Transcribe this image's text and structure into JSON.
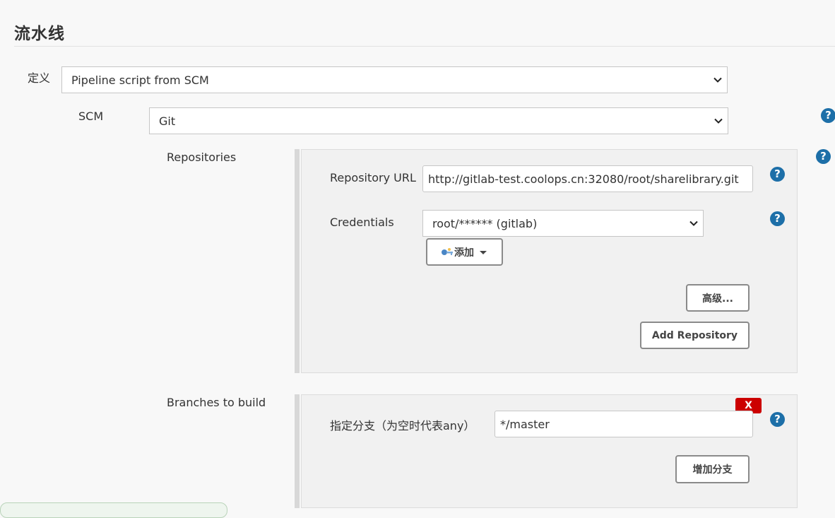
{
  "section": {
    "title": "流水线"
  },
  "definition": {
    "label": "定义",
    "value": "Pipeline script from SCM"
  },
  "scm": {
    "label": "SCM",
    "value": "Git"
  },
  "repositories": {
    "label": "Repositories",
    "url_label": "Repository URL",
    "url_value": "http://gitlab-test.coolops.cn:32080/root/sharelibrary.git",
    "credentials_label": "Credentials",
    "credentials_value": "root/****** (gitlab)",
    "add_label": "添加",
    "advanced_label": "高级...",
    "add_repository_label": "Add Repository"
  },
  "branches": {
    "label": "Branches to build",
    "specifier_label": "指定分支（为空时代表any）",
    "specifier_value": "*/master",
    "delete_label": "X",
    "add_branch_label": "增加分支"
  },
  "icons": {
    "help": "?",
    "help_icon": "help-icon",
    "key_icon": "key-icon",
    "dropdown_icon": "chevron-down-icon"
  },
  "colors": {
    "help": "#1d6fa8",
    "delete": "#cc0000",
    "panel": "#f1f1f1"
  }
}
